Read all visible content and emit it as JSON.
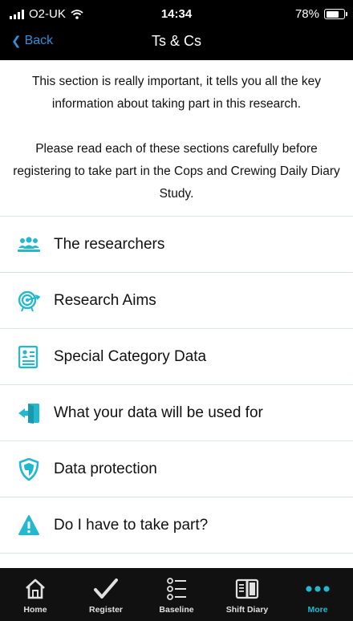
{
  "status_bar": {
    "carrier": "O2-UK",
    "time": "14:34",
    "battery": "78%",
    "battery_level": 0.78
  },
  "nav": {
    "back_label": "Back",
    "title": "Ts & Cs"
  },
  "intro": {
    "paragraph1": "This section is really important, it tells you all the key information about taking part in this research.",
    "paragraph2": "Please read each of these sections carefully before registering to take part in the Cops and Crewing Daily Diary Study."
  },
  "sections": [
    {
      "label": "The researchers",
      "icon": "people-icon"
    },
    {
      "label": "Research Aims",
      "icon": "target-icon"
    },
    {
      "label": "Special Category Data",
      "icon": "document-icon"
    },
    {
      "label": "What your data will be used for",
      "icon": "exit-door-icon"
    },
    {
      "label": "Data protection",
      "icon": "shield-icon"
    },
    {
      "label": "Do I have to take part?",
      "icon": "warning-icon"
    }
  ],
  "tabs": [
    {
      "label": "Home",
      "icon": "home-icon",
      "active": false
    },
    {
      "label": "Register",
      "icon": "checkmark-icon",
      "active": false
    },
    {
      "label": "Baseline",
      "icon": "list-icon",
      "active": false
    },
    {
      "label": "Shift Diary",
      "icon": "book-icon",
      "active": false
    },
    {
      "label": "More",
      "icon": "more-icon",
      "active": true
    }
  ],
  "colors": {
    "accent": "#22b8d0",
    "link": "#2f8fd8",
    "bar": "#000000"
  }
}
